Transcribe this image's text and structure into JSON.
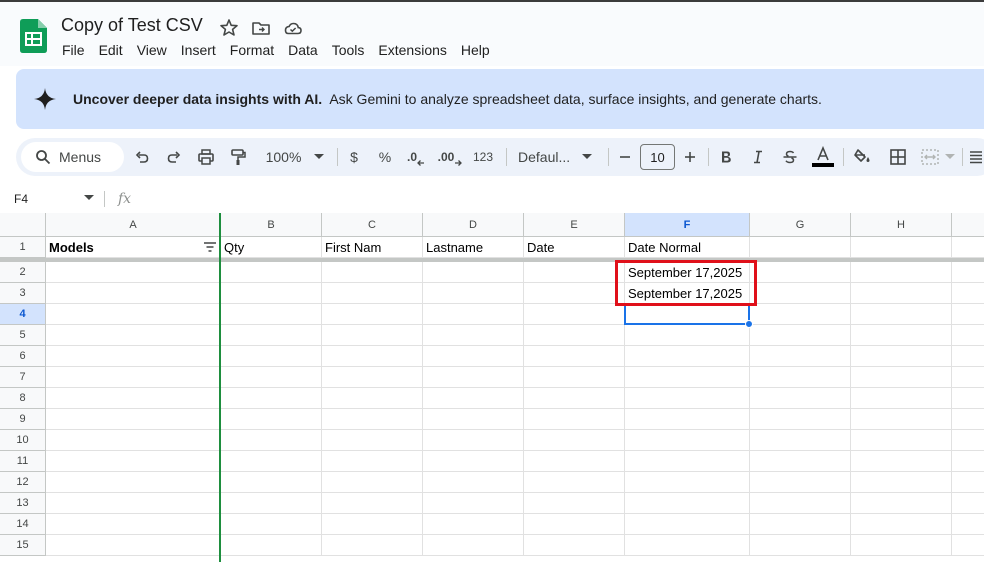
{
  "doc": {
    "title": "Copy of Test CSV",
    "menus": [
      "File",
      "Edit",
      "View",
      "Insert",
      "Format",
      "Data",
      "Tools",
      "Extensions",
      "Help"
    ]
  },
  "banner": {
    "bold_text": "Uncover deeper data insights with AI.",
    "text": "Ask Gemini to analyze spreadsheet data, surface insights, and generate charts."
  },
  "toolbar": {
    "search_label": "Menus",
    "zoom": "100%",
    "currency": "$",
    "percent": "%",
    "decrease_decimal": ".0",
    "increase_decimal": ".00",
    "number_format": "123",
    "font": "Defaul...",
    "font_size": "10"
  },
  "formula_bar": {
    "cell_ref": "F4",
    "fx_label": "fx"
  },
  "sheet": {
    "columns": [
      "A",
      "B",
      "C",
      "D",
      "E",
      "F",
      "G",
      "H"
    ],
    "active_column": "F",
    "active_row": "4",
    "rows": [
      "1",
      "2",
      "3",
      "4",
      "5",
      "6",
      "7",
      "8",
      "9",
      "10",
      "11",
      "12",
      "13",
      "14",
      "15"
    ],
    "cells": {
      "A1": "Models",
      "B1": "Qty",
      "C1": "First Nam",
      "D1": "Lastname",
      "E1": "Date",
      "F1": "Date Normal",
      "F2": "September 17,2025",
      "F3": "September 17,2025"
    }
  },
  "colors": {
    "selection": "#1a73e8",
    "highlight": "#e0101a",
    "banner": "#d3e3fd",
    "accent": "#0b57d0"
  }
}
